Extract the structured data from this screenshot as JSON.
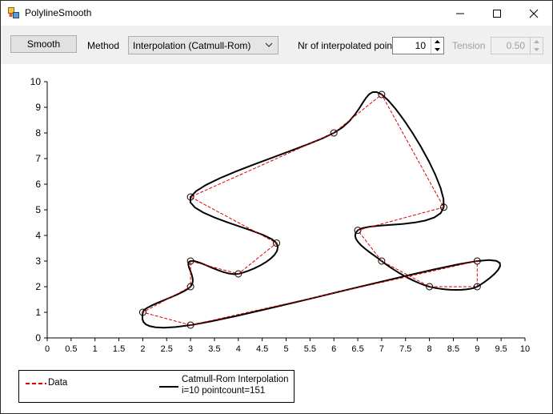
{
  "window": {
    "title": "PolylineSmooth"
  },
  "toolbar": {
    "smooth_label": "Smooth",
    "method_label": "Method",
    "method_value": "Interpolation (Catmull-Rom)",
    "npoints_label": "Nr of interpolated points",
    "npoints_value": "10",
    "tension_label": "Tension",
    "tension_value": "0.50"
  },
  "legend": {
    "data_label": "Data",
    "curve_label": "Catmull-Rom Interpolation",
    "curve_sublabel": "i=10 pointcount=151"
  },
  "colors": {
    "data": "#dd0000",
    "curve": "#000000"
  },
  "chart_data": {
    "type": "line",
    "xlim": [
      0,
      10
    ],
    "ylim": [
      0,
      10
    ],
    "x_ticks": [
      "0",
      "0.5",
      "1",
      "1.5",
      "2",
      "2.5",
      "3",
      "3.5",
      "4",
      "4.5",
      "5",
      "5.5",
      "6",
      "6.5",
      "7",
      "7.5",
      "8",
      "8.5",
      "9",
      "9.5",
      "10"
    ],
    "y_ticks": [
      "0",
      "1",
      "2",
      "3",
      "4",
      "5",
      "6",
      "7",
      "8",
      "9",
      "10"
    ],
    "series": [
      {
        "name": "Data",
        "style": "dashed",
        "points": [
          [
            3,
            0.5
          ],
          [
            2,
            1
          ],
          [
            3,
            2
          ],
          [
            3,
            3
          ],
          [
            4,
            2.5
          ],
          [
            4.8,
            3.7
          ],
          [
            3,
            5.5
          ],
          [
            6,
            8
          ],
          [
            7,
            9.5
          ],
          [
            8.3,
            5.1
          ],
          [
            6.5,
            4.2
          ],
          [
            7,
            3
          ],
          [
            8,
            2
          ],
          [
            9,
            2
          ],
          [
            9,
            3
          ],
          [
            3,
            0.5
          ]
        ]
      },
      {
        "name": "Catmull-Rom Interpolation",
        "style": "solid",
        "points_are": "smooth curve through data points"
      }
    ]
  }
}
